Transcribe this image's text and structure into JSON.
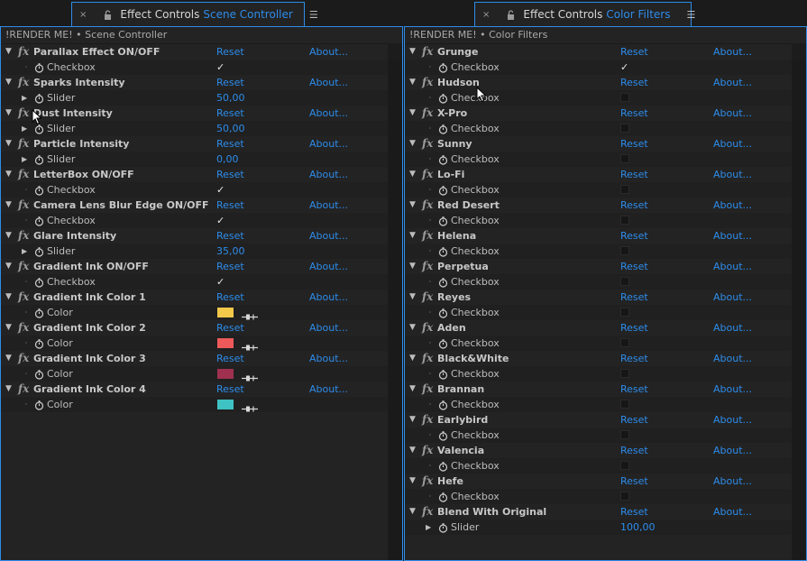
{
  "left_panel": {
    "tab": {
      "close": "×",
      "title": "Effect Controls",
      "comp": "Scene Controller",
      "menu": "☰"
    },
    "breadcrumb": "!RENDER ME! • Scene Controller",
    "effects": [
      {
        "name": "Parallax Effect ON/OFF",
        "reset": "Reset",
        "about": "About...",
        "param": {
          "type": "checkbox",
          "label": "Checkbox",
          "checked": true,
          "value": "✓"
        }
      },
      {
        "name": "Sparks Intensity",
        "reset": "Reset",
        "about": "About...",
        "param": {
          "type": "slider",
          "label": "Slider",
          "value": "50,00"
        }
      },
      {
        "name": "Dust Intensity",
        "reset": "Reset",
        "about": "About...",
        "param": {
          "type": "slider",
          "label": "Slider",
          "value": "50,00"
        }
      },
      {
        "name": "Particle Intensity",
        "reset": "Reset",
        "about": "About...",
        "param": {
          "type": "slider",
          "label": "Slider",
          "value": "0,00"
        }
      },
      {
        "name": "LetterBox ON/OFF",
        "reset": "Reset",
        "about": "About...",
        "param": {
          "type": "checkbox",
          "label": "Checkbox",
          "checked": true,
          "value": "✓"
        }
      },
      {
        "name": "Camera Lens Blur Edge ON/OFF",
        "reset": "Reset",
        "about": "About...",
        "param": {
          "type": "checkbox",
          "label": "Checkbox",
          "checked": true,
          "value": "✓"
        }
      },
      {
        "name": "Glare Intensity",
        "reset": "Reset",
        "about": "About...",
        "param": {
          "type": "slider",
          "label": "Slider",
          "value": "35,00"
        }
      },
      {
        "name": "Gradient Ink ON/OFF",
        "reset": "Reset",
        "about": "About...",
        "param": {
          "type": "checkbox",
          "label": "Checkbox",
          "checked": true,
          "value": "✓"
        }
      },
      {
        "name": "Gradient Ink Color 1",
        "reset": "Reset",
        "about": "About...",
        "param": {
          "type": "color",
          "label": "Color",
          "color": "#f2c84b"
        }
      },
      {
        "name": "Gradient Ink Color 2",
        "reset": "Reset",
        "about": "About...",
        "param": {
          "type": "color",
          "label": "Color",
          "color": "#ee5a5a"
        }
      },
      {
        "name": "Gradient Ink Color 3",
        "reset": "Reset",
        "about": "About...",
        "param": {
          "type": "color",
          "label": "Color",
          "color": "#a0304f"
        }
      },
      {
        "name": "Gradient Ink Color 4",
        "reset": "Reset",
        "about": "About...",
        "param": {
          "type": "color",
          "label": "Color",
          "color": "#3fc2c2"
        }
      }
    ]
  },
  "right_panel": {
    "tab": {
      "close": "×",
      "title": "Effect Controls",
      "comp": "Color Filters",
      "menu": "☰"
    },
    "breadcrumb": "!RENDER ME! • Color Filters",
    "effects": [
      {
        "name": "Grunge",
        "reset": "Reset",
        "about": "About...",
        "param": {
          "type": "checkbox",
          "label": "Checkbox",
          "checked": true,
          "value": "✓"
        }
      },
      {
        "name": "Hudson",
        "reset": "Reset",
        "about": "About...",
        "param": {
          "type": "checkbox",
          "label": "Checkbox",
          "checked": false
        }
      },
      {
        "name": "X-Pro",
        "reset": "Reset",
        "about": "About...",
        "param": {
          "type": "checkbox",
          "label": "Checkbox",
          "checked": false
        }
      },
      {
        "name": "Sunny",
        "reset": "Reset",
        "about": "About...",
        "param": {
          "type": "checkbox",
          "label": "Checkbox",
          "checked": false
        }
      },
      {
        "name": "Lo-Fi",
        "reset": "Reset",
        "about": "About...",
        "param": {
          "type": "checkbox",
          "label": "Checkbox",
          "checked": false
        }
      },
      {
        "name": "Red Desert",
        "reset": "Reset",
        "about": "About...",
        "param": {
          "type": "checkbox",
          "label": "Checkbox",
          "checked": false
        }
      },
      {
        "name": "Helena",
        "reset": "Reset",
        "about": "About...",
        "param": {
          "type": "checkbox",
          "label": "Checkbox",
          "checked": false
        }
      },
      {
        "name": "Perpetua",
        "reset": "Reset",
        "about": "About...",
        "param": {
          "type": "checkbox",
          "label": "Checkbox",
          "checked": false
        }
      },
      {
        "name": "Reyes",
        "reset": "Reset",
        "about": "About...",
        "param": {
          "type": "checkbox",
          "label": "Checkbox",
          "checked": false
        }
      },
      {
        "name": "Aden",
        "reset": "Reset",
        "about": "About...",
        "param": {
          "type": "checkbox",
          "label": "Checkbox",
          "checked": false
        }
      },
      {
        "name": "Black&White",
        "reset": "Reset",
        "about": "About...",
        "param": {
          "type": "checkbox",
          "label": "Checkbox",
          "checked": false
        }
      },
      {
        "name": "Brannan",
        "reset": "Reset",
        "about": "About...",
        "param": {
          "type": "checkbox",
          "label": "Checkbox",
          "checked": false
        }
      },
      {
        "name": "Earlybird",
        "reset": "Reset",
        "about": "About...",
        "param": {
          "type": "checkbox",
          "label": "Checkbox",
          "checked": false
        }
      },
      {
        "name": "Valencia",
        "reset": "Reset",
        "about": "About...",
        "param": {
          "type": "checkbox",
          "label": "Checkbox",
          "checked": false
        }
      },
      {
        "name": "Hefe",
        "reset": "Reset",
        "about": "About...",
        "param": {
          "type": "checkbox",
          "label": "Checkbox",
          "checked": false
        }
      },
      {
        "name": "Blend With Original",
        "reset": "Reset",
        "about": "About...",
        "param": {
          "type": "slider",
          "label": "Slider",
          "value": "100,00"
        }
      }
    ]
  },
  "colors": {
    "accent": "#2d8ceb",
    "tab_square": "#e8821e",
    "panel_bg": "#232323",
    "param_bg": "#202020"
  },
  "icons": {
    "fx": "fx",
    "twirl_open": "▼",
    "twirl_closed": "▶",
    "stopwatch": "stopwatch-icon",
    "eyedropper": "eyedropper-icon",
    "lock": "lock-icon"
  }
}
